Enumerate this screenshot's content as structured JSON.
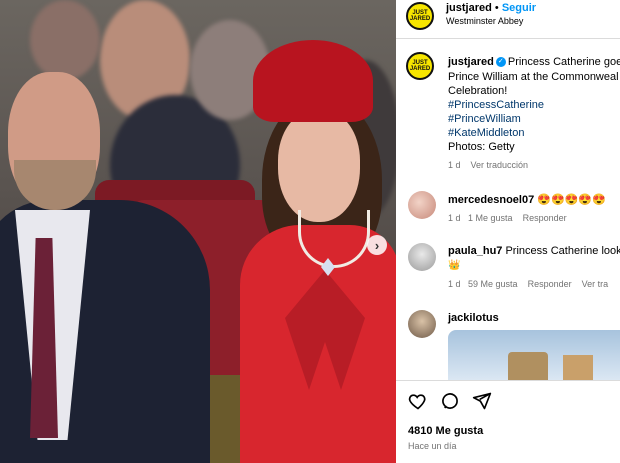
{
  "post": {
    "author": "justjared",
    "follow_label": "Seguir",
    "location": "Westminster Abbey",
    "logo_text": [
      "JUST",
      "JARED"
    ],
    "caption_text": "Princess Catherine goes red to join Prince William at the Commonwealth Day Celebration!",
    "caption_line1": "Princess Catherine goe",
    "caption_line2": "Prince William at the Commonweal",
    "caption_line3": "Celebration!",
    "hashtags": [
      "#PrincessCatherine",
      "#PrinceWilliam",
      "#KateMiddleton"
    ],
    "photo_credit": "Photos: Getty",
    "time": "1 d",
    "see_translation": "Ver traducción"
  },
  "comments": [
    {
      "user": "mercedesnoel07",
      "text": "😍😍😍😍😍",
      "time": "1 d",
      "likes": "1 Me gusta",
      "reply": "Responder"
    },
    {
      "user": "paula_hu7",
      "text": "Princess Catherine looks",
      "emoji": "👑",
      "time": "1 d",
      "likes": "59 Me gusta",
      "reply": "Responder",
      "translate": "Ver tra"
    },
    {
      "user": "jackilotus",
      "text": ""
    }
  ],
  "footer": {
    "likes": "4810 Me gusta",
    "time": "Hace un día"
  },
  "colors": {
    "accent": "#0095f6",
    "link": "#00376b",
    "muted": "#737373",
    "logo_bg": "#f7e600"
  },
  "icons": [
    "heart-icon",
    "comment-icon",
    "share-icon",
    "chevron-right-icon",
    "verified-icon"
  ]
}
